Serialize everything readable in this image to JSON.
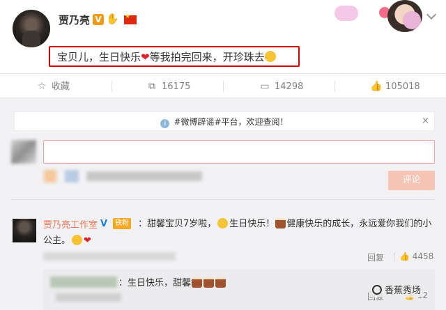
{
  "post": {
    "author": "贾乃亮",
    "verified_badge": "V",
    "text_before_heart": "宝贝儿，生日快乐",
    "text_after_heart": "等我拍完回来，开珍珠去"
  },
  "actions": {
    "favorite": "收藏",
    "repost_count": "16175",
    "comment_count": "14298",
    "like_count": "105018"
  },
  "notice": {
    "text": "#微博辟谣#平台，欢迎查阅！",
    "close": "×"
  },
  "composer": {
    "submit_label": "评论"
  },
  "comment": {
    "author": "贾乃亮工作室",
    "verified_mark": "V",
    "tag": "铁粉",
    "body_1": "：甜馨宝贝7岁啦，",
    "body_2": "生日快乐！",
    "body_3": "健康快乐的成长，永远爱你我们的小",
    "body_4": "公主。",
    "reply_label": "回复",
    "like_count": "4458"
  },
  "nested_reply": {
    "text": "：生日快乐，甜馨",
    "reply_label": "回复",
    "like_count": "12"
  },
  "watermark": "香蕉秀场",
  "colors": {
    "highlight_border": "#d40000",
    "author_link": "#eb7350",
    "submit_button": "#f6c4b4"
  }
}
